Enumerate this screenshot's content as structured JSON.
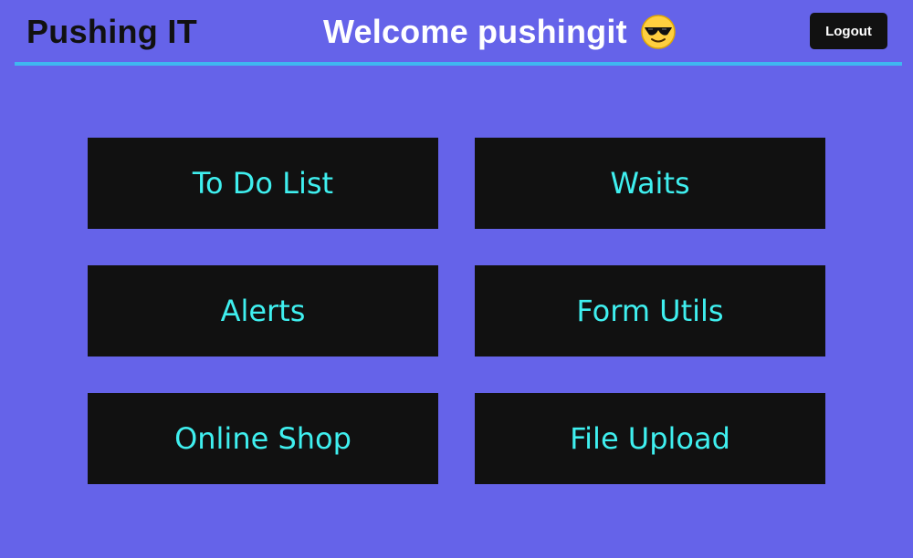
{
  "header": {
    "brand": "Pushing IT",
    "welcome": "Welcome pushingit",
    "emoji_icon": "sunglasses-face-icon",
    "logout_label": "Logout",
    "underline_color": "#3fb7f0"
  },
  "tiles": [
    {
      "label": "To Do List"
    },
    {
      "label": "Waits"
    },
    {
      "label": "Alerts"
    },
    {
      "label": "Form Utils"
    },
    {
      "label": "Online Shop"
    },
    {
      "label": "File Upload"
    }
  ],
  "colors": {
    "background": "#6563e9",
    "tile_background": "#111111",
    "tile_text": "#3fefef",
    "logout_background": "#111111"
  }
}
